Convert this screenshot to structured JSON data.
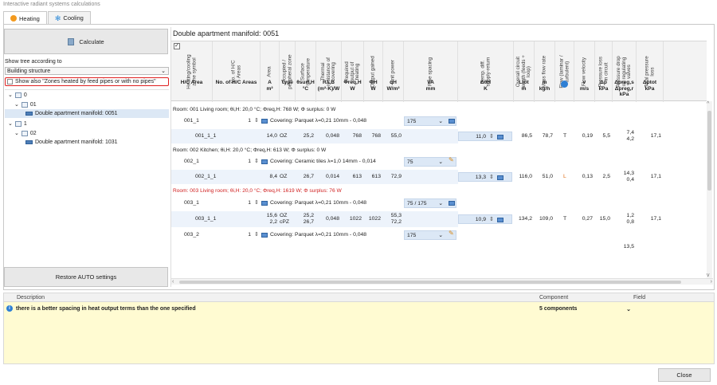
{
  "window_title": "Interactive radiant systems calculations",
  "tabs": [
    {
      "label": "Heating"
    },
    {
      "label": "Cooling"
    }
  ],
  "left": {
    "calculate_label": "Calculate",
    "tree_label": "Show tree according to",
    "tree_select_value": "Building structure",
    "show_also_label": "Show also \"Zones heated by feed pipes or with no pipes\"",
    "tree": [
      "0",
      "01",
      "Double apartment manifold: 0051",
      "1",
      "02",
      "Double apartment manifold: 1031"
    ],
    "restore_label": "Restore AUTO settings"
  },
  "right": {
    "title": "Double apartment manifold: 0051",
    "columns": [
      {
        "v": "Heating/cooling zone symbol",
        "s": "H/C Area"
      },
      {
        "v": "No. of H/C Areas",
        "s": "No. of H/C Areas"
      },
      {
        "v": "Area",
        "s": "A\nm²"
      },
      {
        "v": "Occupied / peripheral zone",
        "s": "Type"
      },
      {
        "v": "Surface temperature",
        "s": "θsurf,H\n°C"
      },
      {
        "v": "Thermal resistance of covering",
        "s": "Rλ,B\n(m²·K)/W"
      },
      {
        "v": "Required output of heating",
        "s": "Φreq,H\nW"
      },
      {
        "v": "Output gained",
        "s": "ΦH\nW"
      },
      {
        "v": "Unit power",
        "s": "qH\nW/m²"
      },
      {
        "v": "Pipe spacing",
        "s": "VA\nmm"
      },
      {
        "v": "Temp. diff. supply-return",
        "s": "ΔθH\nK"
      },
      {
        "v": "Overall circuit length (feeds + loop)",
        "s": "Ltot\nm"
      },
      {
        "v": "Mass flow rate",
        "s": "ṁ\nkg/h"
      },
      {
        "v": "Flow (laminar / turbulent)",
        "s": ""
      },
      {
        "v": "Flow velocity",
        "s": "v\nm/s"
      },
      {
        "v": "Pressure loss in circuit",
        "s": "Δp\nkPa"
      },
      {
        "v": "Pressure drop on regulating valves",
        "s": "Δpreg,s\nΔpreg,r\nkPa"
      },
      {
        "v": "Total pressure loss",
        "s": "Δptot\nkPa"
      }
    ],
    "rooms": [
      {
        "label": "Room: 001 Living room; θi,H: 20,0 °C; Φreq,H: 768 W; Φ surplus: 0 W",
        "red": false
      },
      {
        "label": "Room: 002 Kitchen; θi,H: 20,0 °C; Φreq,H: 613 W; Φ surplus: 0 W",
        "red": false
      },
      {
        "label": "Room: 003 Living room; θi,H: 20,0 °C; Φreq,H: 1619 W; Φ surplus: 76 W",
        "red": true
      }
    ],
    "rows": {
      "r001": {
        "name": "001_1",
        "n": "1",
        "cov": "Covering: Parquet λ=0,21 10mm - 0,048",
        "va": "175"
      },
      "r001_1": {
        "name": "001_1_1",
        "a": "14,0",
        "t": "OZ",
        "ts": "25,2",
        "r": "0,048",
        "req": "768",
        "out": "768",
        "q": "55,0",
        "dt": "11,0",
        "l": "86,5",
        "m": "78,7",
        "f": "T",
        "v": "0,19",
        "dp": "5,5",
        "reg": "7,4\n4,2",
        "tot": "17,1"
      },
      "r002": {
        "name": "002_1",
        "n": "1",
        "cov": "Covering: Ceramic tiles λ=1,0 14mm - 0,014",
        "va": "75"
      },
      "r002_1": {
        "name": "002_1_1",
        "a": "8,4",
        "t": "OZ",
        "ts": "26,7",
        "r": "0,014",
        "req": "613",
        "out": "613",
        "q": "72,9",
        "dt": "13,3",
        "l": "116,0",
        "m": "51,0",
        "f": "L",
        "v": "0,13",
        "dp": "2,5",
        "reg": "14,3\n0,4",
        "tot": "17,1"
      },
      "r003": {
        "name": "003_1",
        "n": "1",
        "cov": "Covering: Parquet λ=0,21 10mm - 0,048",
        "va": "75 / 175"
      },
      "r003_1": {
        "name": "003_1_1",
        "a": "15,6\n2,2",
        "t": "OZ\ncPZ",
        "ts": "25,2\n26,7",
        "r": "0,048",
        "req": "1022",
        "out": "1022",
        "q": "55,3\n72,2",
        "dt": "10,9",
        "l": "134,2",
        "m": "109,0",
        "f": "T",
        "v": "0,27",
        "dp": "15,0",
        "reg": "1,2\n0,8",
        "tot": "17,1"
      },
      "r003_2": {
        "name": "003_2",
        "n": "1",
        "cov": "Covering: Parquet λ=0,21 10mm - 0,048",
        "va": "175"
      },
      "r003_2_partial": {
        "reg": "13,5"
      }
    }
  },
  "bottom": {
    "headers": [
      "Description",
      "Component",
      "Field"
    ],
    "message": "there is a better spacing in heat output terms than the one specified",
    "component": "5 components"
  },
  "close_label": "Close",
  "colors": {
    "accent": "#2e7fd4",
    "warning_red": "#d02020",
    "message_bg": "#fffbd2"
  }
}
